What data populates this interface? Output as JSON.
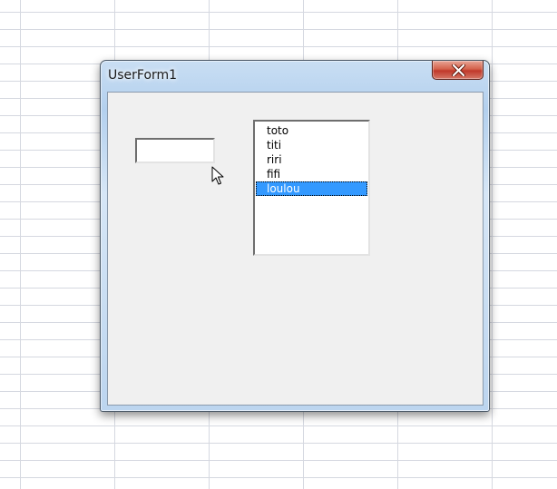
{
  "window": {
    "title": "UserForm1",
    "close_icon": "close-x-icon"
  },
  "form": {
    "textbox_value": "",
    "listbox": {
      "items": [
        "toto",
        "titi",
        "riri",
        "fifi",
        "loulou"
      ],
      "selected_index": 4
    }
  },
  "colors": {
    "selection": "#3399ff",
    "close_button": "#c0392b",
    "client_bg": "#f0f0f0"
  },
  "cursor_icon": "arrow-cursor-icon"
}
